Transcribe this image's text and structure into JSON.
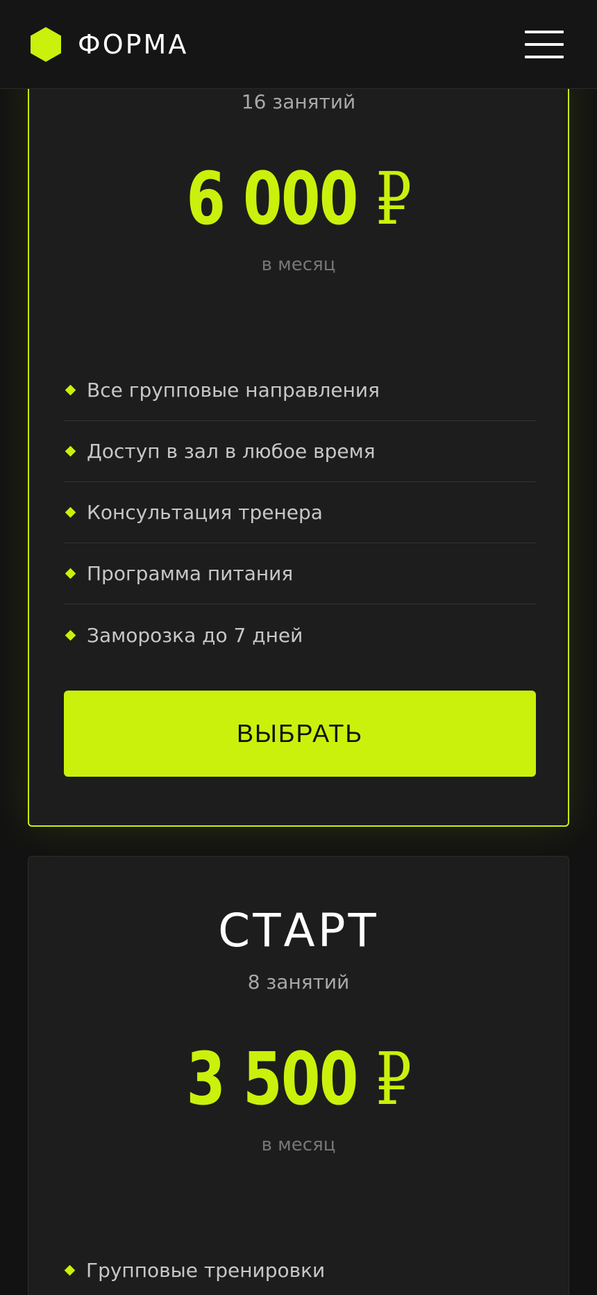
{
  "header": {
    "brand": "ФОРМА",
    "accent_color": "#c9f10c",
    "logo_icon": "hexagon-icon",
    "menu_icon": "hamburger-menu-icon"
  },
  "plans": [
    {
      "sessions": "16 занятий",
      "price": "6 000",
      "currency": "₽",
      "period": "в месяц",
      "features": [
        "Все групповые направления",
        "Доступ в зал в любое время",
        "Консультация тренера",
        "Программа питания",
        "Заморозка до 7 дней"
      ],
      "button_label": "ВЫБРАТЬ"
    },
    {
      "title": "СТАРТ",
      "sessions": "8 занятий",
      "price": "3 500",
      "currency": "₽",
      "period": "в месяц",
      "features": [
        "Групповые тренировки"
      ]
    }
  ]
}
